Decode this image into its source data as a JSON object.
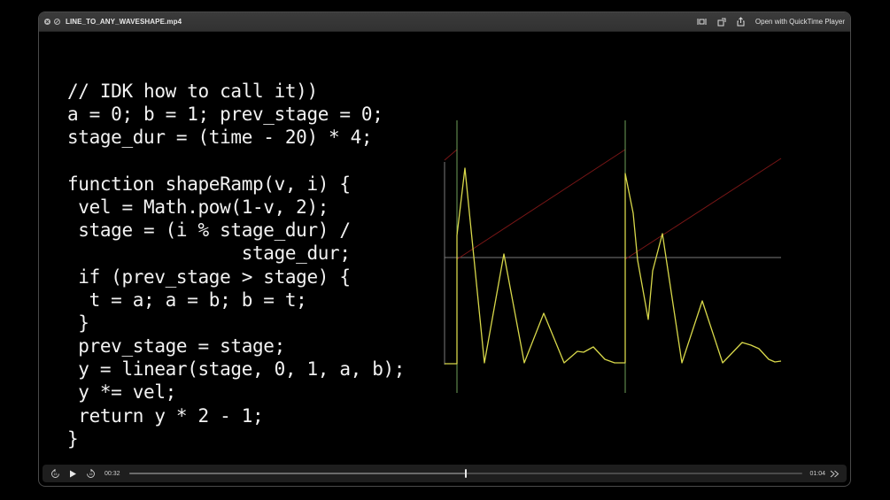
{
  "window": {
    "title": "LINE_TO_ANY_WAVESHAPE.mp4",
    "open_with_label": "Open with QuickTime Player"
  },
  "code": {
    "lines": [
      "// IDK how to call it))",
      "a = 0; b = 1; prev_stage = 0;",
      "stage_dur = (time - 20) * 4;",
      "",
      "function shapeRamp(v, i) {",
      " vel = Math.pow(1-v, 2);",
      " stage = (i % stage_dur) /",
      "                stage_dur;",
      " if (prev_stage > stage) {",
      "  t = a; a = b; b = t;",
      " }",
      " prev_stage = stage;",
      " y = linear(stage, 0, 1, a, b);",
      " y *= vel;",
      " return y * 2 - 1;",
      "}"
    ]
  },
  "player": {
    "current_time": "00:32",
    "duration": "01:04",
    "progress": 0.5
  },
  "icons": {
    "close": "close-icon",
    "disable": "disable-icon",
    "trim": "trim-icon",
    "rotate": "rotate-icon",
    "share": "share-icon",
    "skip_back": "skip-back-15-icon",
    "play": "play-icon",
    "skip_forward": "skip-forward-15-icon",
    "fast_forward": "fast-forward-icon",
    "fullscreen": "fullscreen-icon"
  },
  "colors": {
    "background": "#000000",
    "code_text": "#f2f2f2",
    "wave": "#d8d84a",
    "ramp": "#7a1616",
    "marker": "#6fa05a",
    "axis": "#7a7a7a"
  }
}
